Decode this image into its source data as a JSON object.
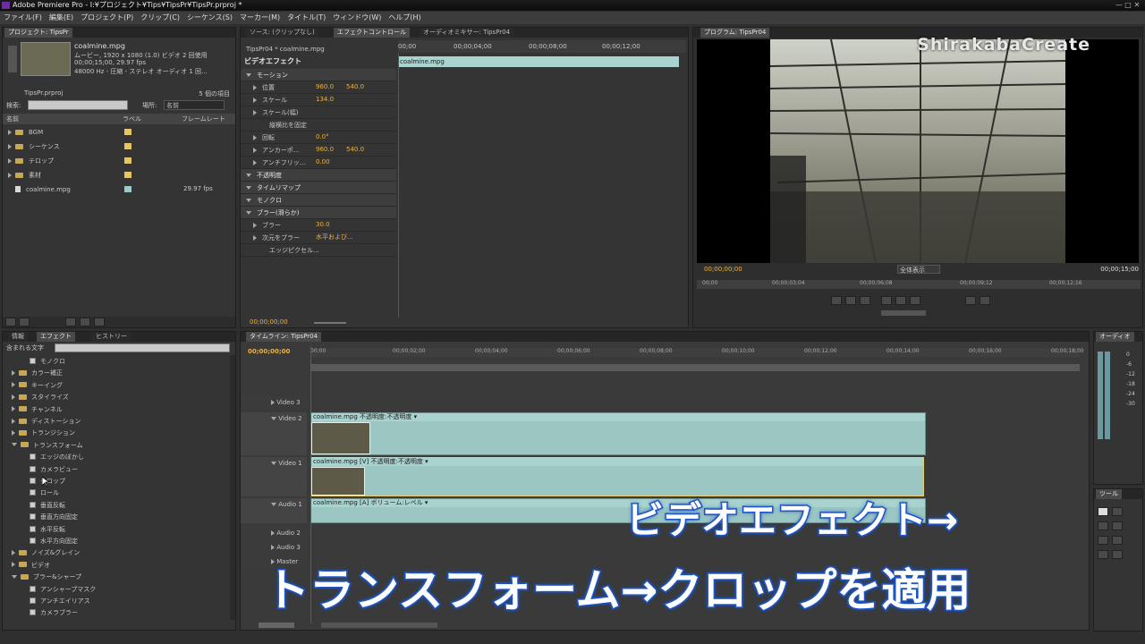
{
  "app": {
    "title": "Adobe Premiere Pro - I:¥プロジェクト¥Tips¥TipsPr¥TipsPr.prproj *",
    "window_controls": [
      "—",
      "□",
      "✕"
    ]
  },
  "menu": [
    "ファイル(F)",
    "編集(E)",
    "プロジェクト(P)",
    "クリップ(C)",
    "シーケンス(S)",
    "マーカー(M)",
    "タイトル(T)",
    "ウィンドウ(W)",
    "ヘルプ(H)"
  ],
  "project": {
    "tab": "プロジェクト: TipsPr",
    "clip_name": "coalmine.mpg",
    "info": [
      "ムービー, 1920 x 1080 (1.0)  ビデオ 2 回使用",
      "00;00;15;00, 29.97 fps",
      "48000 Hz - 圧縮 - ステレオ  オーディオ 1 回..."
    ],
    "project_file": "TipsPr.prproj",
    "count": "5 個の項目",
    "search_label": "検索:",
    "place_label": "場所:",
    "place_value": "名前",
    "columns": [
      "名前",
      "ラベル",
      "フレームレート"
    ],
    "items": [
      {
        "name": "BGM",
        "type": "folder",
        "label_color": "#e6c56a",
        "fps": ""
      },
      {
        "name": "シーケンス",
        "type": "folder",
        "label_color": "#e6c56a",
        "fps": ""
      },
      {
        "name": "テロップ",
        "type": "folder",
        "label_color": "#e6c56a",
        "fps": ""
      },
      {
        "name": "素材",
        "type": "folder",
        "label_color": "#e6c56a",
        "fps": ""
      },
      {
        "name": "coalmine.mpg",
        "type": "file",
        "label_color": "#9ccbc6",
        "fps": "29.97 fps"
      }
    ]
  },
  "effect_controls": {
    "tabs": [
      "ソース: (クリップなし)",
      "エフェクトコントロール",
      "オーディオミキサー: TipsPr04"
    ],
    "sequence": "TipsPr04 * coalmine.mpg",
    "ruler": [
      "00;00",
      "00;00;04;00",
      "00;00;08;00",
      "00;00;12;00"
    ],
    "section": "ビデオエフェクト",
    "clip_bar": "coalmine.mpg",
    "timecode": "00;00;00;00",
    "rows": [
      {
        "name": "モーション",
        "level": 0,
        "v1": "",
        "v2": ""
      },
      {
        "name": "位置",
        "level": 1,
        "v1": "960.0",
        "v2": "540.0"
      },
      {
        "name": "スケール",
        "level": 1,
        "v1": "134.0",
        "v2": ""
      },
      {
        "name": "スケール(幅)",
        "level": 1,
        "v1": "",
        "v2": ""
      },
      {
        "name": "縦横比を固定",
        "level": 2,
        "v1": "",
        "v2": ""
      },
      {
        "name": "回転",
        "level": 1,
        "v1": "0.0°",
        "v2": ""
      },
      {
        "name": "アンカーポ...",
        "level": 1,
        "v1": "960.0",
        "v2": "540.0"
      },
      {
        "name": "アンチフリッ...",
        "level": 1,
        "v1": "0.00",
        "v2": ""
      },
      {
        "name": "不透明度",
        "level": 0,
        "v1": "",
        "v2": ""
      },
      {
        "name": "タイムリマップ",
        "level": 0,
        "v1": "",
        "v2": ""
      },
      {
        "name": "モノクロ",
        "level": 0,
        "v1": "",
        "v2": ""
      },
      {
        "name": "ブラー(滑らか)",
        "level": 0,
        "v1": "",
        "v2": ""
      },
      {
        "name": "ブラー",
        "level": 1,
        "v1": "30.0",
        "v2": ""
      },
      {
        "name": "次元をブラー",
        "level": 1,
        "v1": "水平および...",
        "v2": ""
      },
      {
        "name": "エッジピクセル...",
        "level": 2,
        "v1": "",
        "v2": ""
      }
    ]
  },
  "program": {
    "tab": "プログラム: TipsPr04",
    "timecode_in": "00;00;00;00",
    "fit": "全体表示",
    "timecode_dur": "00;00;15;00",
    "ruler": [
      "00;00",
      "00;00;03;04",
      "00;00;06;08",
      "00;00;09;12",
      "00;00;12;16"
    ]
  },
  "watermark": "ShirakabaCreate",
  "effects_panel": {
    "tabs": [
      "情報",
      "エフェクト",
      "ヒストリー"
    ],
    "search_label": "含まれる文字",
    "items": [
      {
        "name": "モノクロ",
        "kind": "fx",
        "indent": 2
      },
      {
        "name": "カラー補正",
        "kind": "folder",
        "indent": 1
      },
      {
        "name": "キーイング",
        "kind": "folder",
        "indent": 1
      },
      {
        "name": "スタイライズ",
        "kind": "folder",
        "indent": 1
      },
      {
        "name": "チャンネル",
        "kind": "folder",
        "indent": 1
      },
      {
        "name": "ディストーション",
        "kind": "folder",
        "indent": 1
      },
      {
        "name": "トランジション",
        "kind": "folder",
        "indent": 1
      },
      {
        "name": "トランスフォーム",
        "kind": "open",
        "indent": 1
      },
      {
        "name": "エッジのぼかし",
        "kind": "fx",
        "indent": 2
      },
      {
        "name": "カメラビュー",
        "kind": "fx",
        "indent": 2
      },
      {
        "name": "クロップ",
        "kind": "fx",
        "indent": 2
      },
      {
        "name": "ロール",
        "kind": "fx",
        "indent": 2
      },
      {
        "name": "垂直反転",
        "kind": "fx",
        "indent": 2
      },
      {
        "name": "垂直方向固定",
        "kind": "fx",
        "indent": 2
      },
      {
        "name": "水平反転",
        "kind": "fx",
        "indent": 2
      },
      {
        "name": "水平方向固定",
        "kind": "fx",
        "indent": 2
      },
      {
        "name": "ノイズ&グレイン",
        "kind": "folder",
        "indent": 1
      },
      {
        "name": "ビデオ",
        "kind": "folder",
        "indent": 1
      },
      {
        "name": "ブラー&シャープ",
        "kind": "open",
        "indent": 1
      },
      {
        "name": "アンシャープマスク",
        "kind": "fx",
        "indent": 2
      },
      {
        "name": "アンチエイリアス",
        "kind": "fx",
        "indent": 2
      },
      {
        "name": "カメラブラー",
        "kind": "fx",
        "indent": 2
      }
    ]
  },
  "timeline": {
    "tab": "タイムライン: TipsPr04",
    "timecode": "00;00;00;00",
    "ruler": [
      "00;00",
      "00;00;02;00",
      "00;00;04;00",
      "00;00;06;00",
      "00;00;08;00",
      "00;00;10;00",
      "00;00;12;00",
      "00;00;14;00",
      "00;00;16;00",
      "00;00;18;00"
    ],
    "tracks": [
      "Video 3",
      "Video 2",
      "Video 1",
      "Audio 1",
      "Audio 2",
      "Audio 3",
      "Master"
    ],
    "v2_clip": "coalmine.mpg 不透明度:不透明度 ▾",
    "v1_clip": "coalmine.mpg [V] 不透明度:不透明度 ▾",
    "a1_clip": "coalmine.mpg [A] ボリューム:レベル ▾"
  },
  "audio_meter": {
    "tab": "オーディオ",
    "labels": [
      "0",
      "-6",
      "-12",
      "-18",
      "-24",
      "-30"
    ]
  },
  "tools": {
    "tab": "ツール"
  },
  "overlay": {
    "line1": "ビデオエフェクト→",
    "line2": "トランスフォーム→クロップを適用",
    "color": "#1e56c8"
  }
}
